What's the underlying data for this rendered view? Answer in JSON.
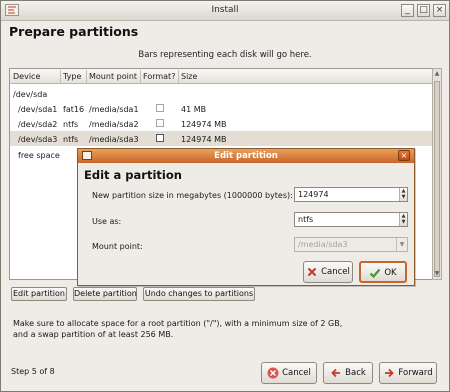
{
  "window": {
    "title": "Install",
    "minimize_glyph": "_",
    "maximize_glyph": "□",
    "close_glyph": "×"
  },
  "page": {
    "heading": "Prepare partitions",
    "bars_note": "Bars representing each disk will go here."
  },
  "table": {
    "columns": [
      "Device",
      "Type",
      "Mount point",
      "Format?",
      "Size"
    ],
    "disk": "/dev/sda",
    "rows": [
      {
        "device": "/dev/sda1",
        "type": "fat16",
        "mount": "/media/sda1",
        "format": false,
        "size": "41 MB"
      },
      {
        "device": "/dev/sda2",
        "type": "ntfs",
        "mount": "/media/sda2",
        "format": false,
        "size": "124974 MB"
      },
      {
        "device": "/dev/sda3",
        "type": "ntfs",
        "mount": "/media/sda3",
        "format": false,
        "size": "124974 MB",
        "selected": true
      }
    ],
    "free_space": "free space"
  },
  "actions": {
    "edit": "Edit partition",
    "delete": "Delete partition",
    "undo": "Undo changes to partitions"
  },
  "hint": "Make sure to allocate space for a root partition (\"/\"), with a minimum size of 2 GB, and a swap partition of at least 256 MB.",
  "footer": {
    "step": "Step 5 of 8",
    "cancel": "Cancel",
    "back": "Back",
    "forward": "Forward"
  },
  "dialog": {
    "title": "Edit partition",
    "heading": "Edit a partition",
    "size_label": "New partition size in megabytes (1000000 bytes):",
    "size_value": "124974",
    "use_as_label": "Use as:",
    "use_as_value": "ntfs",
    "mount_label": "Mount point:",
    "mount_value": "/media/sda3",
    "cancel": "Cancel",
    "ok": "OK"
  },
  "colors": {
    "dialog_title": "#d27535",
    "selection": "#e3ddd3"
  }
}
